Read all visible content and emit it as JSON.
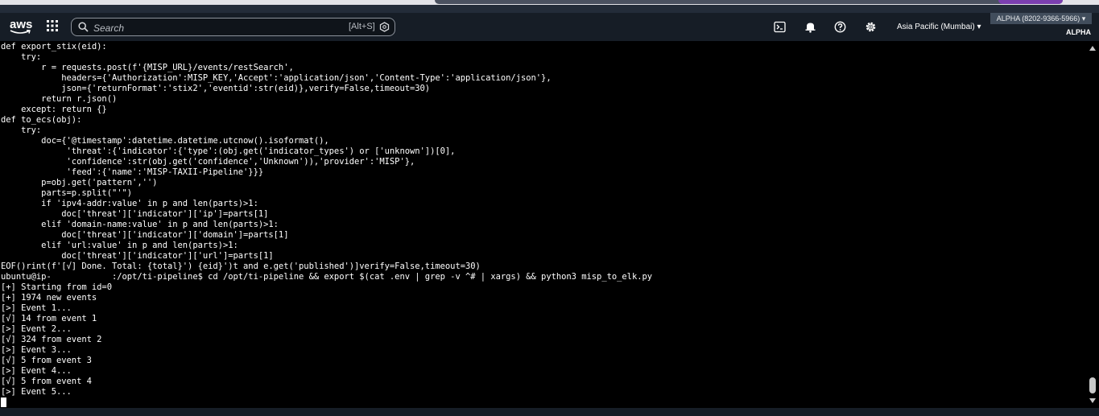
{
  "header": {
    "logo_text": "aws",
    "search_placeholder": "Search",
    "search_shortcut": "[Alt+S]",
    "region": "Asia Pacific (Mumbai) ▾",
    "account": "ALPHA (8202-9366-5966) ▾",
    "account_role": "ALPHA",
    "icons": [
      "cloudshell-icon",
      "bell-icon",
      "help-icon",
      "gear-icon"
    ]
  },
  "terminal": {
    "lines": [
      "def export_stix(eid):",
      "    try:",
      "        r = requests.post(f'{MISP_URL}/events/restSearch',",
      "            headers={'Authorization':MISP_KEY,'Accept':'application/json','Content-Type':'application/json'},",
      "            json={'returnFormat':'stix2','eventid':str(eid)},verify=False,timeout=30)",
      "        return r.json()",
      "    except: return {}",
      "def to_ecs(obj):",
      "    try:",
      "        doc={'@timestamp':datetime.datetime.utcnow().isoformat(),",
      "             'threat':{'indicator':{'type':(obj.get('indicator_types') or ['unknown'])[0],",
      "             'confidence':str(obj.get('confidence','Unknown')),'provider':'MISP'},",
      "             'feed':{'name':'MISP-TAXII-Pipeline'}}}",
      "        p=obj.get('pattern','')",
      "        parts=p.split(\"'\")",
      "        if 'ipv4-addr:value' in p and len(parts)>1:",
      "            doc['threat']['indicator']['ip']=parts[1]",
      "        elif 'domain-name:value' in p and len(parts)>1:",
      "            doc['threat']['indicator']['domain']=parts[1]",
      "        elif 'url:value' in p and len(parts)>1:",
      "            doc['threat']['indicator']['url']=parts[1]",
      "EOF()rint(f'[√] Done. Total: {total}') {eid}')t and e.get('published')]verify=False,timeout=30)",
      "ubuntu@ip-            :/opt/ti-pipeline$ cd /opt/ti-pipeline && export $(cat .env | grep -v ^# | xargs) && python3 misp_to_elk.py",
      "[+] Starting from id=0",
      "[+] 1974 new events",
      "[>] Event 1...",
      "[√] 14 from event 1",
      "[>] Event 2...",
      "[√] 324 from event 2",
      "[>] Event 3...",
      "[√] 5 from event 3",
      "[>] Event 4...",
      "[√] 5 from event 4",
      "[>] Event 5..."
    ]
  }
}
